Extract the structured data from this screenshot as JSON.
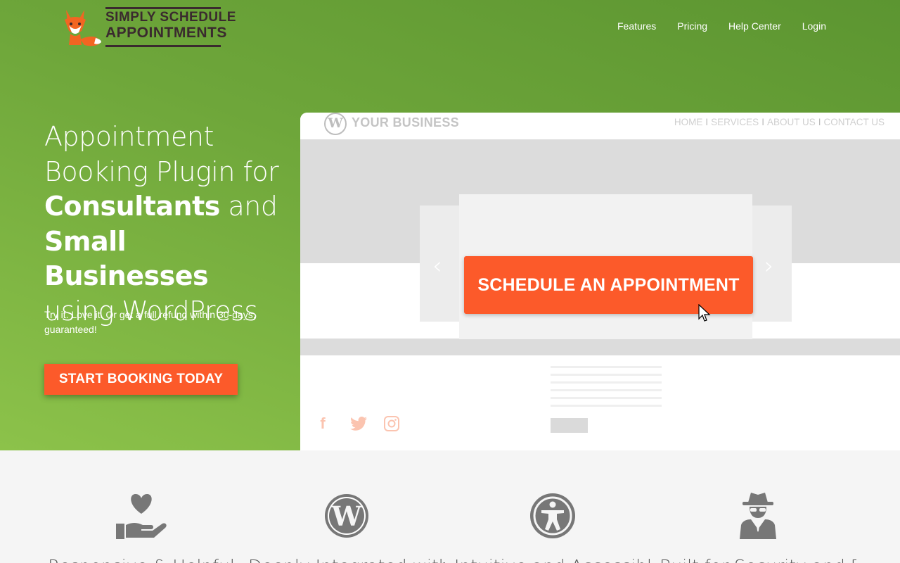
{
  "header": {
    "logo": {
      "line1": "SIMPLY SCHEDULE",
      "line2": "APPOINTMENTS",
      "icon": "fox-icon"
    },
    "nav": [
      "Features",
      "Pricing",
      "Help Center",
      "Login"
    ]
  },
  "hero": {
    "headline": {
      "part1": "Appointment Booking Plugin for",
      "bold1": "Consultants",
      "part2": "and",
      "bold2": "Small Businesses",
      "part3": "using WordPress"
    },
    "subtext": "Try it. Love it. Or get a full refund within 30-days, guaranteed!",
    "cta_label": "START BOOKING TODAY"
  },
  "mock_site": {
    "brand": "YOUR BUSINESS",
    "nav": [
      "HOME",
      "SERVICES",
      "ABOUT US",
      "CONTACT US"
    ],
    "nav_separator": "I",
    "button_label": "SCHEDULE AN APPOINTMENT",
    "social_icons": [
      "facebook-icon",
      "twitter-icon",
      "instagram-icon"
    ]
  },
  "features": [
    {
      "icon": "heart-hand-icon",
      "label": "Responsive & Helpful"
    },
    {
      "icon": "wordpress-icon",
      "label": "Deeply Integrated with"
    },
    {
      "icon": "accessibility-icon",
      "label": "Intuitive and Accessible"
    },
    {
      "icon": "spy-icon",
      "label": "Built for Security and Data"
    }
  ],
  "colors": {
    "hero_green": "#6ea63a",
    "accent_orange": "#fc5a2a",
    "icon_gray": "#777777"
  }
}
